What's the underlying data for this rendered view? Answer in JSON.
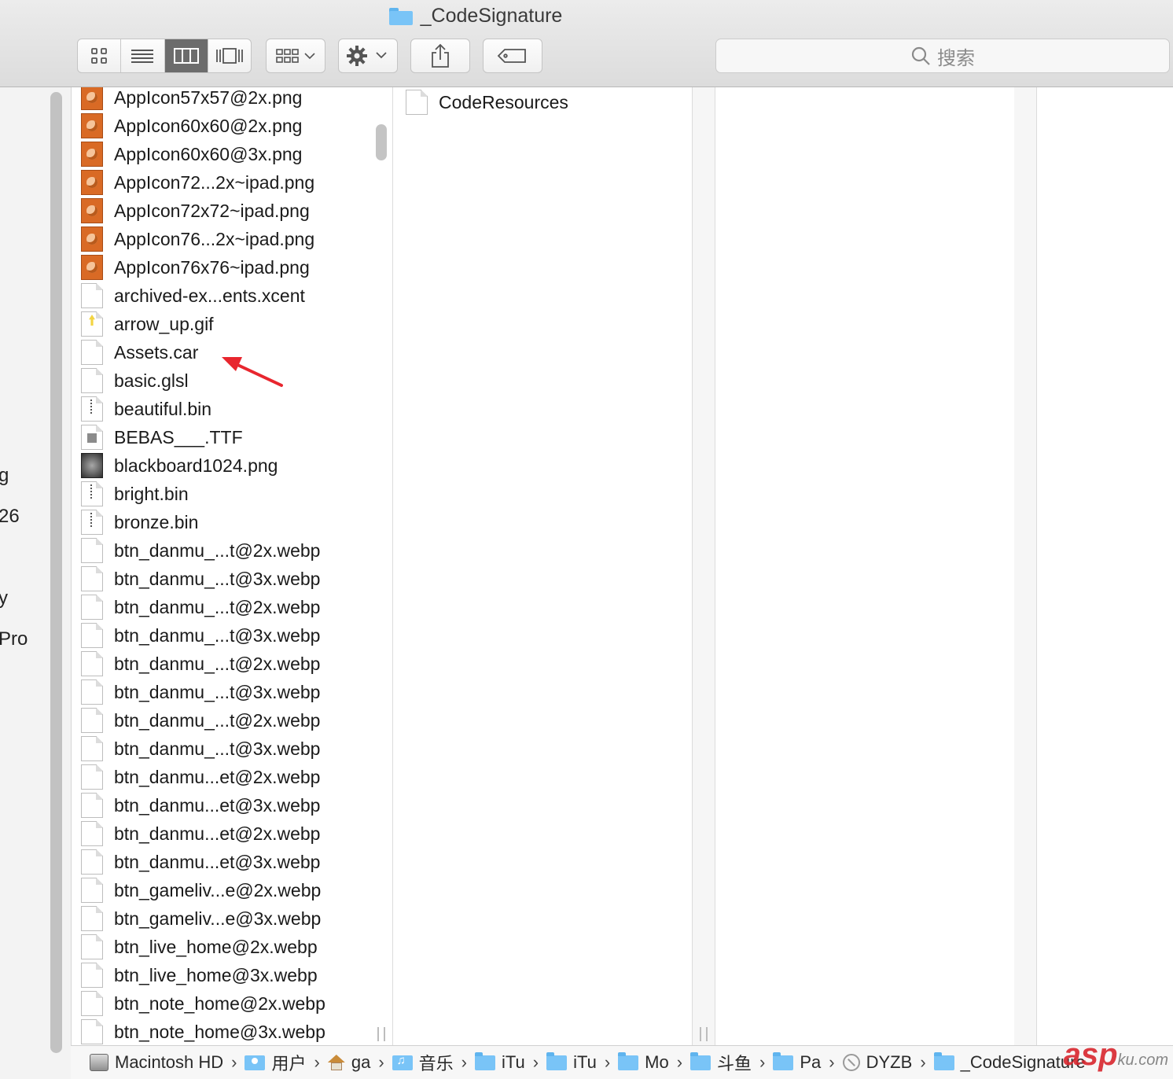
{
  "window": {
    "title": "_CodeSignature"
  },
  "toolbar": {
    "search_placeholder": "搜索"
  },
  "sidebar": {
    "fragments": [
      "g",
      "26",
      "y",
      "Pro"
    ]
  },
  "column1": {
    "files": [
      {
        "name": "AppIcon57x57@2x.png",
        "icon": "png"
      },
      {
        "name": "AppIcon60x60@2x.png",
        "icon": "png"
      },
      {
        "name": "AppIcon60x60@3x.png",
        "icon": "png"
      },
      {
        "name": "AppIcon72...2x~ipad.png",
        "icon": "png"
      },
      {
        "name": "AppIcon72x72~ipad.png",
        "icon": "png"
      },
      {
        "name": "AppIcon76...2x~ipad.png",
        "icon": "png"
      },
      {
        "name": "AppIcon76x76~ipad.png",
        "icon": "png"
      },
      {
        "name": "archived-ex...ents.xcent",
        "icon": "doc"
      },
      {
        "name": "arrow_up.gif",
        "icon": "gif"
      },
      {
        "name": "Assets.car",
        "icon": "doc"
      },
      {
        "name": "basic.glsl",
        "icon": "doc"
      },
      {
        "name": "beautiful.bin",
        "icon": "bin"
      },
      {
        "name": "BEBAS___.TTF",
        "icon": "ttf"
      },
      {
        "name": "blackboard1024.png",
        "icon": "dark"
      },
      {
        "name": "bright.bin",
        "icon": "bin"
      },
      {
        "name": "bronze.bin",
        "icon": "bin"
      },
      {
        "name": "btn_danmu_...t@2x.webp",
        "icon": "doc"
      },
      {
        "name": "btn_danmu_...t@3x.webp",
        "icon": "doc"
      },
      {
        "name": "btn_danmu_...t@2x.webp",
        "icon": "doc"
      },
      {
        "name": "btn_danmu_...t@3x.webp",
        "icon": "doc"
      },
      {
        "name": "btn_danmu_...t@2x.webp",
        "icon": "doc"
      },
      {
        "name": "btn_danmu_...t@3x.webp",
        "icon": "doc"
      },
      {
        "name": "btn_danmu_...t@2x.webp",
        "icon": "doc"
      },
      {
        "name": "btn_danmu_...t@3x.webp",
        "icon": "doc"
      },
      {
        "name": "btn_danmu...et@2x.webp",
        "icon": "doc"
      },
      {
        "name": "btn_danmu...et@3x.webp",
        "icon": "doc"
      },
      {
        "name": "btn_danmu...et@2x.webp",
        "icon": "doc"
      },
      {
        "name": "btn_danmu...et@3x.webp",
        "icon": "doc"
      },
      {
        "name": "btn_gameliv...e@2x.webp",
        "icon": "doc"
      },
      {
        "name": "btn_gameliv...e@3x.webp",
        "icon": "doc"
      },
      {
        "name": "btn_live_home@2x.webp",
        "icon": "doc"
      },
      {
        "name": "btn_live_home@3x.webp",
        "icon": "doc"
      },
      {
        "name": "btn_note_home@2x.webp",
        "icon": "doc"
      },
      {
        "name": "btn_note_home@3x.webp",
        "icon": "doc"
      }
    ]
  },
  "column2": {
    "files": [
      {
        "name": "CodeResources",
        "icon": "doc"
      }
    ]
  },
  "pathbar": {
    "items": [
      {
        "label": "Macintosh HD",
        "icon": "hd"
      },
      {
        "label": "用户",
        "icon": "user"
      },
      {
        "label": "ga",
        "icon": "home"
      },
      {
        "label": "音乐",
        "icon": "music"
      },
      {
        "label": "iTu",
        "icon": "folder"
      },
      {
        "label": "iTu",
        "icon": "folder"
      },
      {
        "label": "Mo",
        "icon": "folder"
      },
      {
        "label": "斗鱼",
        "icon": "folder"
      },
      {
        "label": "Pa",
        "icon": "folder"
      },
      {
        "label": "DYZB",
        "icon": "app"
      },
      {
        "label": "_CodeSignature",
        "icon": "folder"
      }
    ]
  },
  "watermark": {
    "brand": "asp",
    "suffix": "ku.com"
  },
  "colors": {
    "folder": "#79c4f7",
    "annotation": "#e8262e",
    "png_icon": "#d96a25"
  }
}
